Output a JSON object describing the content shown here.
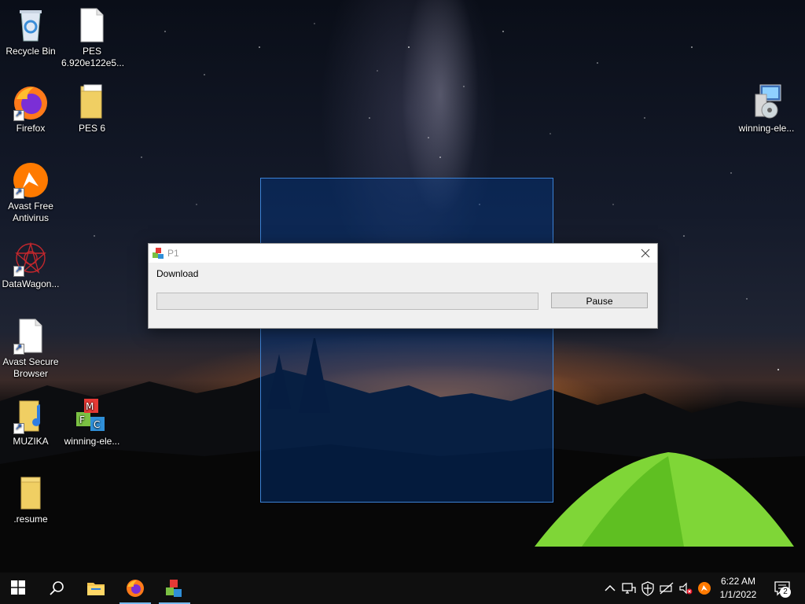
{
  "desktop": {
    "icons": [
      {
        "label": "Recycle Bin",
        "icon": "recycle-bin-icon"
      },
      {
        "label": "PES 6.920e122e5...",
        "icon": "file-icon"
      },
      {
        "label": "Firefox",
        "icon": "firefox-icon"
      },
      {
        "label": "PES 6",
        "icon": "folder-icon"
      },
      {
        "label": "Avast Free Antivirus",
        "icon": "avast-icon"
      },
      {
        "label": "DataWagon...",
        "icon": "datawagon-icon"
      },
      {
        "label": "Avast Secure Browser",
        "icon": "file-icon"
      },
      {
        "label": "MUZIKA",
        "icon": "music-folder-icon"
      },
      {
        "label": "winning-ele...",
        "icon": "mfc-blocks-icon"
      },
      {
        "label": ".resume",
        "icon": "folder-icon"
      },
      {
        "label": "winning-ele...",
        "icon": "installer-icon"
      }
    ]
  },
  "dialog": {
    "title": "P1",
    "label": "Download",
    "progress": 0,
    "pause_label": "Pause"
  },
  "taskbar": {
    "apps": [
      "start-icon",
      "search-icon",
      "file-explorer-icon",
      "firefox-icon",
      "mfc-blocks-icon"
    ],
    "tray": [
      "chevron-up-icon",
      "network-icon",
      "security-shield-icon",
      "battery-icon",
      "volume-muted-icon",
      "avast-icon"
    ],
    "time": "6:22 AM",
    "date": "1/1/2022",
    "notification_count": "2"
  }
}
